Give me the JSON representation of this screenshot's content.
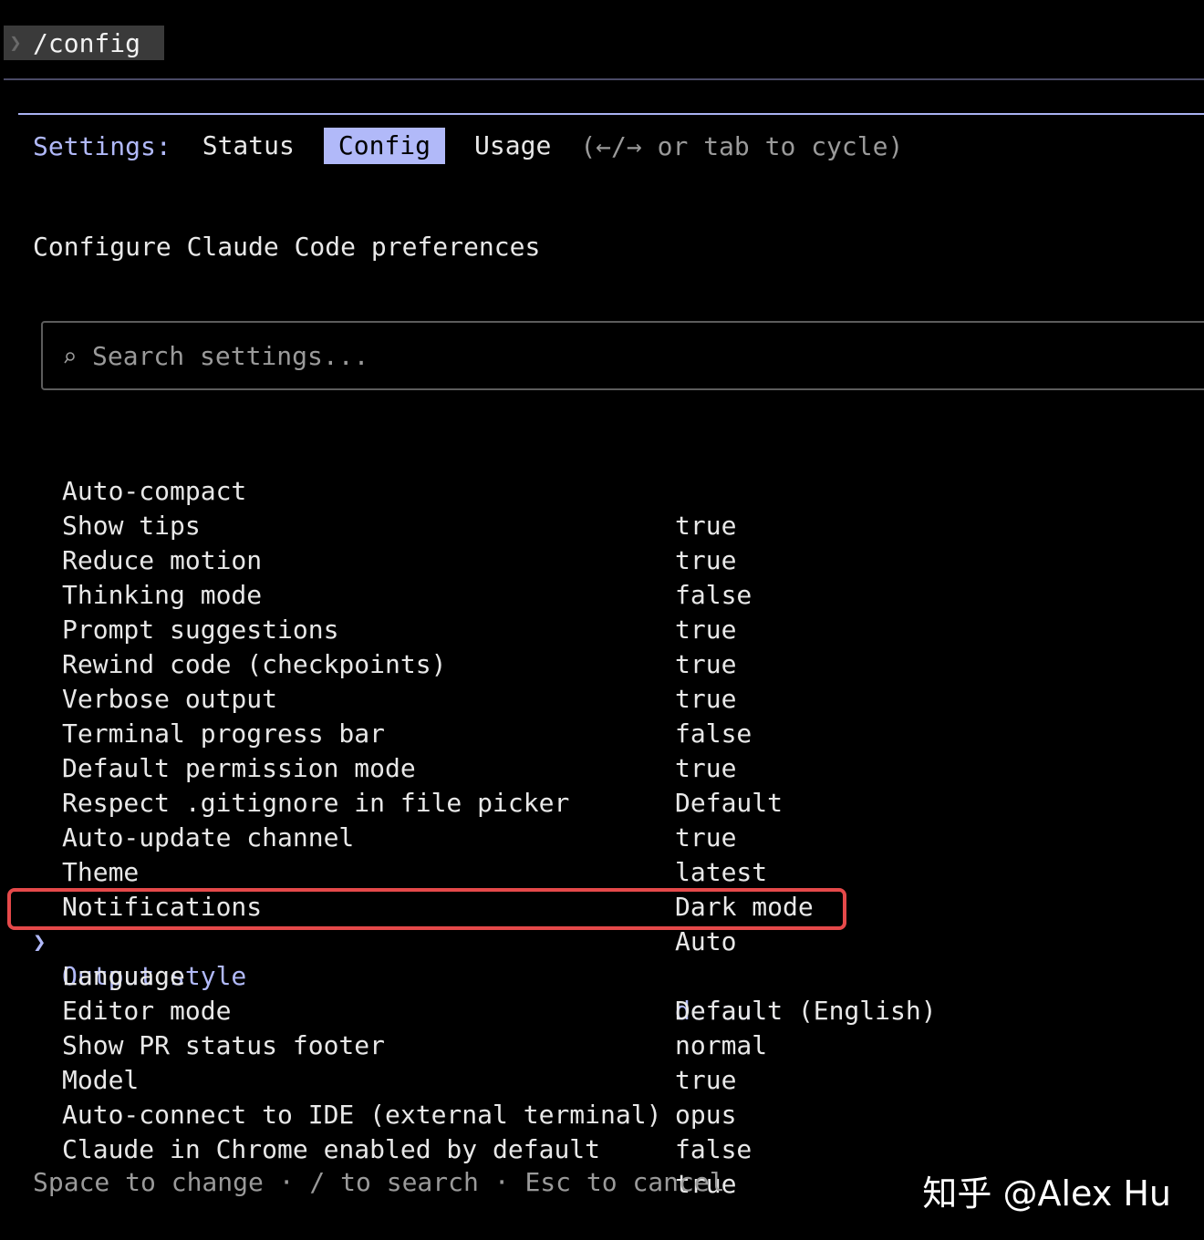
{
  "command": {
    "prompt_icon": "chevron-right-icon",
    "text": "/config"
  },
  "tabs": {
    "label": "Settings:",
    "items": [
      {
        "label": "Status",
        "active": false
      },
      {
        "label": "Config",
        "active": true
      },
      {
        "label": "Usage",
        "active": false
      }
    ],
    "hint": "(←/→ or tab to cycle)"
  },
  "subtitle": "Configure Claude Code preferences",
  "search": {
    "icon": "search-icon",
    "value": "",
    "placeholder": "Search settings..."
  },
  "settings": [
    {
      "name": "Auto-compact",
      "value": "true"
    },
    {
      "name": "Show tips",
      "value": "true"
    },
    {
      "name": "Reduce motion",
      "value": "false"
    },
    {
      "name": "Thinking mode",
      "value": "true"
    },
    {
      "name": "Prompt suggestions",
      "value": "true"
    },
    {
      "name": "Rewind code (checkpoints)",
      "value": "true"
    },
    {
      "name": "Verbose output",
      "value": "false"
    },
    {
      "name": "Terminal progress bar",
      "value": "true"
    },
    {
      "name": "Default permission mode",
      "value": "Default"
    },
    {
      "name": "Respect .gitignore in file picker",
      "value": "true"
    },
    {
      "name": "Auto-update channel",
      "value": "latest"
    },
    {
      "name": "Theme",
      "value": "Dark mode"
    },
    {
      "name": "Notifications",
      "value": "Auto"
    },
    {
      "name": "Output style",
      "value": "default",
      "selected": true
    },
    {
      "name": "Language",
      "value": "Default (English)"
    },
    {
      "name": "Editor mode",
      "value": "normal"
    },
    {
      "name": "Show PR status footer",
      "value": "true"
    },
    {
      "name": "Model",
      "value": "opus"
    },
    {
      "name": "Auto-connect to IDE (external terminal)",
      "value": "false"
    },
    {
      "name": "Claude in Chrome enabled by default",
      "value": "true"
    }
  ],
  "selection_pointer": "❯",
  "footer": "Space to change · / to search · Esc to cancel",
  "watermark": "知乎 @Alex Hu",
  "colors": {
    "accent": "#b1b9f9",
    "background": "#000000",
    "highlight_border": "#e5494a",
    "muted_text": "#9a9a9a"
  }
}
